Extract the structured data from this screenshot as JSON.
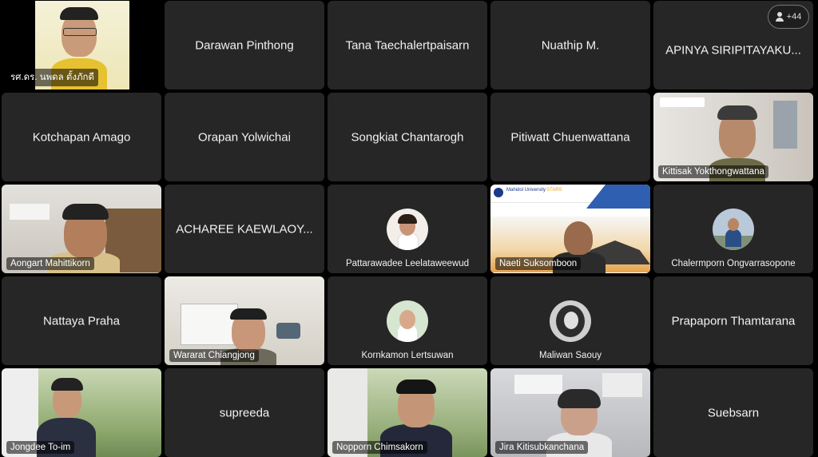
{
  "participants_badge": {
    "count_label": "+44",
    "icon": "person-icon"
  },
  "tiles": [
    {
      "name": "รศ.ดร. นพดล ตั้งภักดี",
      "kind": "video"
    },
    {
      "name": "Darawan Pinthong",
      "kind": "name"
    },
    {
      "name": "Tana Taechalertpaisarn",
      "kind": "name"
    },
    {
      "name": "Nuathip M.",
      "kind": "name"
    },
    {
      "name": "APINYA SIRIPITAYAKU...",
      "kind": "name"
    },
    {
      "name": "Kotchapan Amago",
      "kind": "name"
    },
    {
      "name": "Orapan Yolwichai",
      "kind": "name"
    },
    {
      "name": "Songkiat Chantarogh",
      "kind": "name"
    },
    {
      "name": "Pitiwatt Chuenwattana",
      "kind": "name"
    },
    {
      "name": "Kittisak Yokthongwattana",
      "kind": "video"
    },
    {
      "name": "Aongart Mahittikorn",
      "kind": "video"
    },
    {
      "name": "ACHAREE KAEWLAOY...",
      "kind": "name"
    },
    {
      "name": "Pattarawadee Leelataweewud",
      "kind": "avatar"
    },
    {
      "name": "Naeti Suksomboon",
      "kind": "video"
    },
    {
      "name": "Chalermporn Ongvarrasopone",
      "kind": "avatar"
    },
    {
      "name": "Nattaya Praha",
      "kind": "name"
    },
    {
      "name": "Wararat Chiangjong",
      "kind": "video"
    },
    {
      "name": "Kornkamon Lertsuwan",
      "kind": "avatar"
    },
    {
      "name": "Maliwan Saouy",
      "kind": "avatar"
    },
    {
      "name": "Prapaporn Thamtarana",
      "kind": "name"
    },
    {
      "name": "Jongdee To-im",
      "kind": "video"
    },
    {
      "name": "supreeda",
      "kind": "name"
    },
    {
      "name": "Nopporn Chimsakorn",
      "kind": "video"
    },
    {
      "name": "Jira Kitisubkanchana",
      "kind": "video"
    },
    {
      "name": "Suebsarn",
      "kind": "name"
    }
  ],
  "slide": {
    "org": "Mahidol University",
    "tag": "STARS"
  }
}
